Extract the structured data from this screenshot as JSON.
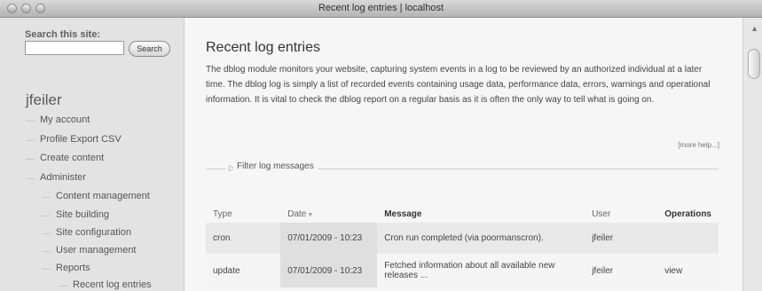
{
  "window": {
    "title": "Recent log entries | localhost"
  },
  "sidebar": {
    "search": {
      "title": "Search this site:",
      "button_label": "Search",
      "value": ""
    },
    "username": "jfeiler",
    "items": [
      "My account",
      "Profile Export CSV",
      "Create content",
      "Administer",
      "Content management",
      "Site building",
      "Site configuration",
      "User management",
      "Reports",
      "Recent log entries"
    ]
  },
  "main": {
    "title": "Recent log entries",
    "intro": "The dblog module monitors your website, capturing system events in a log to be reviewed by an authorized individual at a later time. The dblog log is simply a list of recorded events containing usage data, performance data, errors, warnings and operational information. It is vital to check the dblog report on a regular basis as it is often the only way to tell what is going on.",
    "more_help": "[more help...]",
    "filter_label": "Filter log messages",
    "table": {
      "headers": [
        "Type",
        "Date",
        "Message",
        "User",
        "Operations"
      ],
      "rows": [
        {
          "type": "cron",
          "date": "07/01/2009 - 10:23",
          "message": "Cron run completed (via poormanscron).",
          "user": "jfeiler",
          "operations": ""
        },
        {
          "type": "update",
          "date": "07/01/2009 - 10:23",
          "message": "Fetched information about all available new releases ...",
          "user": "jfeiler",
          "operations": "view"
        }
      ]
    }
  },
  "icons": {
    "sort": "▼",
    "filter": "▷",
    "scroll_up": "▲"
  }
}
